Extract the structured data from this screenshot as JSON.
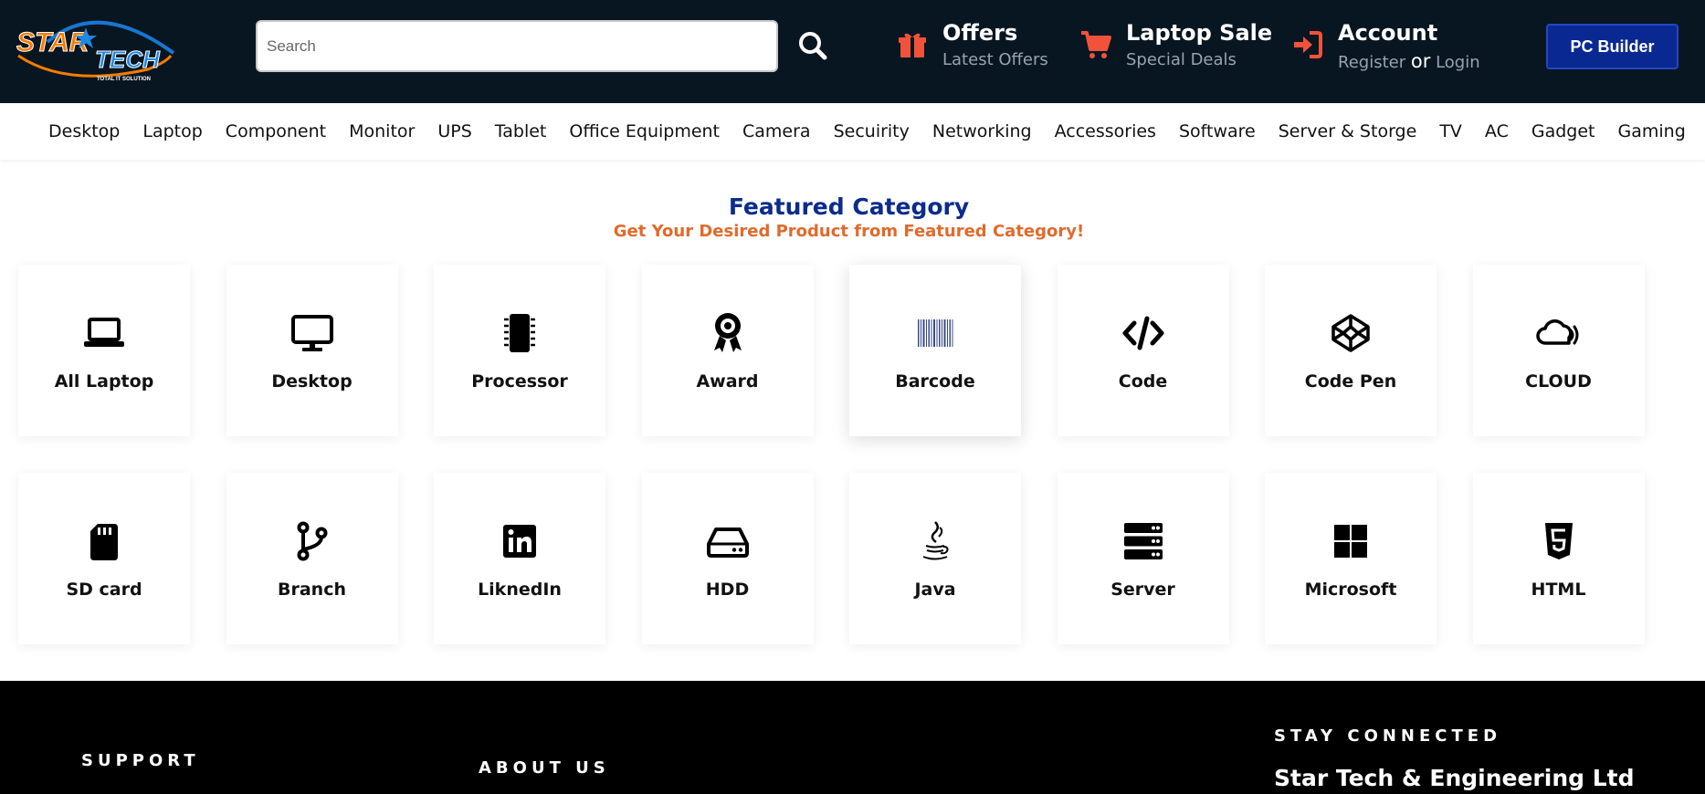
{
  "header": {
    "logo": {
      "brand_line1": "STAR",
      "brand_line2": "TECH",
      "tagline": "TOTAL IT SOLUTION"
    },
    "search": {
      "placeholder": "Search"
    },
    "items": [
      {
        "title": "Offers",
        "subtitle": "Latest Offers",
        "icon": "gift-icon"
      },
      {
        "title": "Laptop Sale",
        "subtitle": "Special Deals",
        "icon": "cart-icon"
      },
      {
        "title": "Account",
        "register": "Register",
        "or": "or",
        "login": "Login",
        "icon": "login-icon"
      }
    ],
    "pc_builder": "PC Builder",
    "accent_color": "#f0533a",
    "header_bg": "#081621"
  },
  "nav": [
    "Desktop",
    "Laptop",
    "Component",
    "Monitor",
    "UPS",
    "Tablet",
    "Office Equipment",
    "Camera",
    "Secuirity",
    "Networking",
    "Accessories",
    "Software",
    "Server & Storge",
    "TV",
    "AC",
    "Gadget",
    "Gaming"
  ],
  "featured": {
    "title": "Featured Category",
    "subtitle": "Get Your Desired Product from Featured Category!",
    "categories": [
      {
        "label": "All Laptop",
        "icon": "laptop-icon"
      },
      {
        "label": "Desktop",
        "icon": "desktop-icon"
      },
      {
        "label": "Processor",
        "icon": "processor-icon"
      },
      {
        "label": "Award",
        "icon": "award-icon"
      },
      {
        "label": "Barcode",
        "icon": "barcode-icon"
      },
      {
        "label": "Code",
        "icon": "code-icon"
      },
      {
        "label": "Code Pen",
        "icon": "codepen-icon"
      },
      {
        "label": "CLOUD",
        "icon": "cloud-icon"
      },
      {
        "label": "SD card",
        "icon": "sd-card-icon"
      },
      {
        "label": "Branch",
        "icon": "branch-icon"
      },
      {
        "label": "LiknedIn",
        "icon": "linkedin-icon"
      },
      {
        "label": "HDD",
        "icon": "hdd-icon"
      },
      {
        "label": "Java",
        "icon": "java-icon"
      },
      {
        "label": "Server",
        "icon": "server-icon"
      },
      {
        "label": "Microsoft",
        "icon": "microsoft-icon"
      },
      {
        "label": "HTML",
        "icon": "html5-icon"
      }
    ]
  },
  "footer": {
    "support": "SUPPORT",
    "about": "ABOUT US",
    "stay_connected": "STAY CONNECTED",
    "company": "Star Tech & Engineering Ltd"
  }
}
